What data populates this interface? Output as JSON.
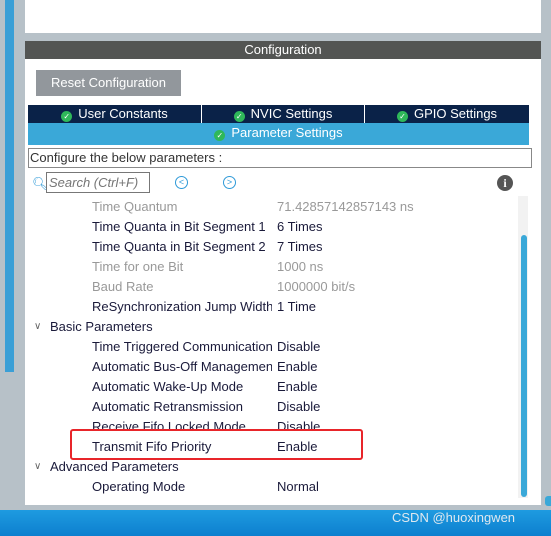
{
  "header": {
    "title": "Configuration"
  },
  "reset_button": "Reset Configuration",
  "tabs": [
    {
      "label": "User Constants"
    },
    {
      "label": "NVIC Settings"
    },
    {
      "label": "GPIO Settings"
    },
    {
      "label": "Parameter Settings",
      "active": true
    }
  ],
  "instructions": "Configure the below parameters :",
  "search": {
    "placeholder": "Search (Ctrl+F)",
    "value": ""
  },
  "rows": [
    {
      "label": "Time Quantum",
      "value": "71.42857142857143 ns",
      "disabled": true
    },
    {
      "label": "Time Quanta in Bit Segment 1",
      "value": "6 Times"
    },
    {
      "label": "Time Quanta in Bit Segment 2",
      "value": "7 Times"
    },
    {
      "label": "Time for one Bit",
      "value": "1000 ns",
      "disabled": true
    },
    {
      "label": "Baud Rate",
      "value": "1000000 bit/s",
      "disabled": true
    },
    {
      "label": "ReSynchronization Jump Width",
      "value": "1 Time"
    },
    {
      "group": "Basic Parameters"
    },
    {
      "label": "Time Triggered Communication Mode",
      "value": "Disable"
    },
    {
      "label": "Automatic Bus-Off Management",
      "value": "Enable"
    },
    {
      "label": "Automatic Wake-Up Mode",
      "value": "Enable"
    },
    {
      "label": "Automatic Retransmission",
      "value": "Disable"
    },
    {
      "label": "Receive Fifo Locked Mode",
      "value": "Disable"
    },
    {
      "label": "Transmit Fifo Priority",
      "value": "Enable",
      "highlighted": true
    },
    {
      "group": "Advanced Parameters"
    },
    {
      "label": "Operating Mode",
      "value": "Normal"
    }
  ],
  "watermark": "CSDN @huoxingwen",
  "colors": {
    "tab_dark": "#0a2248",
    "tab_active": "#3aa8d8",
    "highlight": "#e8252a",
    "header": "#535553"
  }
}
